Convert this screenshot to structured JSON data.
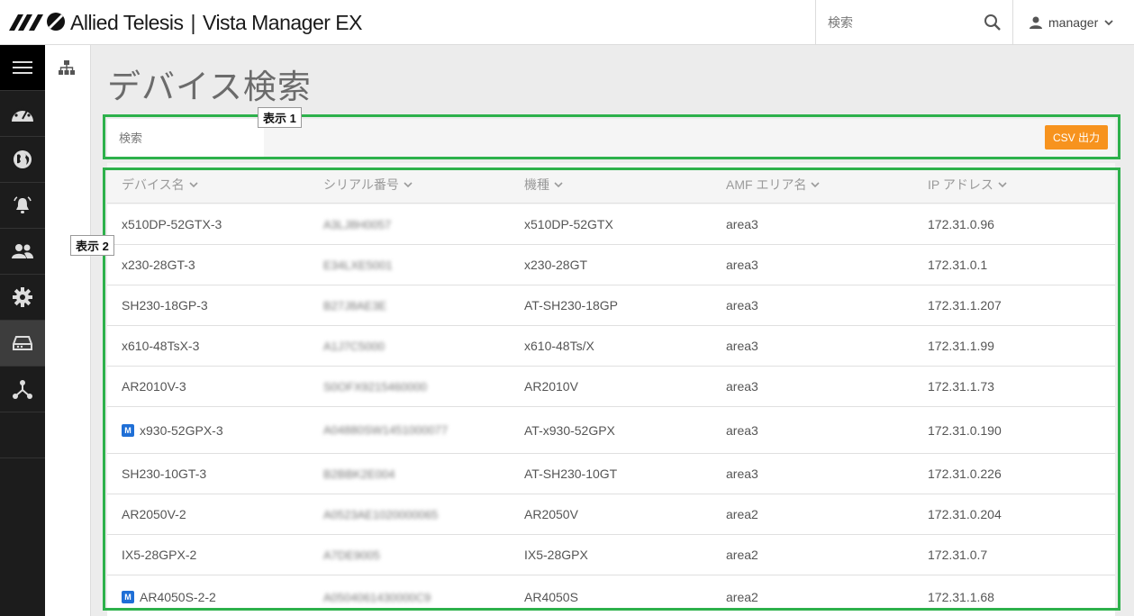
{
  "header": {
    "brand_name": "Allied Telesis",
    "separator": "|",
    "product_name": "Vista Manager EX",
    "search_placeholder": "検索",
    "user_name": "manager"
  },
  "sidebar": {
    "items": [
      {
        "icon": "menu-icon"
      },
      {
        "icon": "dashboard-icon"
      },
      {
        "icon": "globe-icon"
      },
      {
        "icon": "alarm-icon"
      },
      {
        "icon": "users-icon"
      },
      {
        "icon": "gear-icon"
      },
      {
        "icon": "storage-icon",
        "active": true
      },
      {
        "icon": "topology-icon"
      }
    ]
  },
  "page": {
    "title": "デバイス検索"
  },
  "toolbar": {
    "search_placeholder": "検索",
    "csv_button": "CSV 出力"
  },
  "table": {
    "columns": [
      "デバイス名",
      "シリアル番号",
      "機種",
      "AMF エリア名",
      "IP アドレス"
    ],
    "rows": [
      {
        "name": "x510DP-52GTX-3",
        "serial": "A3LJ8H0057",
        "model": "x510DP-52GTX",
        "area": "area3",
        "ip": "172.31.0.96",
        "master": false
      },
      {
        "name": "x230-28GT-3",
        "serial": "E34LXE5001",
        "model": "x230-28GT",
        "area": "area3",
        "ip": "172.31.0.1",
        "master": false
      },
      {
        "name": "SH230-18GP-3",
        "serial": "B27J8AE3E",
        "model": "AT-SH230-18GP",
        "area": "area3",
        "ip": "172.31.1.207",
        "master": false
      },
      {
        "name": "x610-48TsX-3",
        "serial": "A1J7C5000",
        "model": "x610-48Ts/X",
        "area": "area3",
        "ip": "172.31.1.99",
        "master": false
      },
      {
        "name": "AR2010V-3",
        "serial": "S0OFX9215460000",
        "model": "AR2010V",
        "area": "area3",
        "ip": "172.31.1.73",
        "master": false
      },
      {
        "name": "x930-52GPX-3",
        "serial": "A04880SW1451000077",
        "model": "AT-x930-52GPX",
        "area": "area3",
        "ip": "172.31.0.190",
        "master": true
      },
      {
        "name": "SH230-10GT-3",
        "serial": "B2BBK2E004",
        "model": "AT-SH230-10GT",
        "area": "area3",
        "ip": "172.31.0.226",
        "master": false
      },
      {
        "name": "AR2050V-2",
        "serial": "A0523AE1020000065",
        "model": "AR2050V",
        "area": "area2",
        "ip": "172.31.0.204",
        "master": false
      },
      {
        "name": "IX5-28GPX-2",
        "serial": "A7DE9005",
        "model": "IX5-28GPX",
        "area": "area2",
        "ip": "172.31.0.7",
        "master": false
      },
      {
        "name": "AR4050S-2-2",
        "serial": "A0504061430000C9",
        "model": "AR4050S",
        "area": "area2",
        "ip": "172.31.1.68",
        "master": true
      }
    ]
  },
  "annotations": {
    "label1": "表示 1",
    "label2": "表示 2",
    "master_badge": "M"
  },
  "colors": {
    "accent_orange": "#f7931e",
    "annotation_green": "#2db14b",
    "sidebar_dark": "#1c1c1c",
    "master_blue": "#1f6fd6"
  }
}
